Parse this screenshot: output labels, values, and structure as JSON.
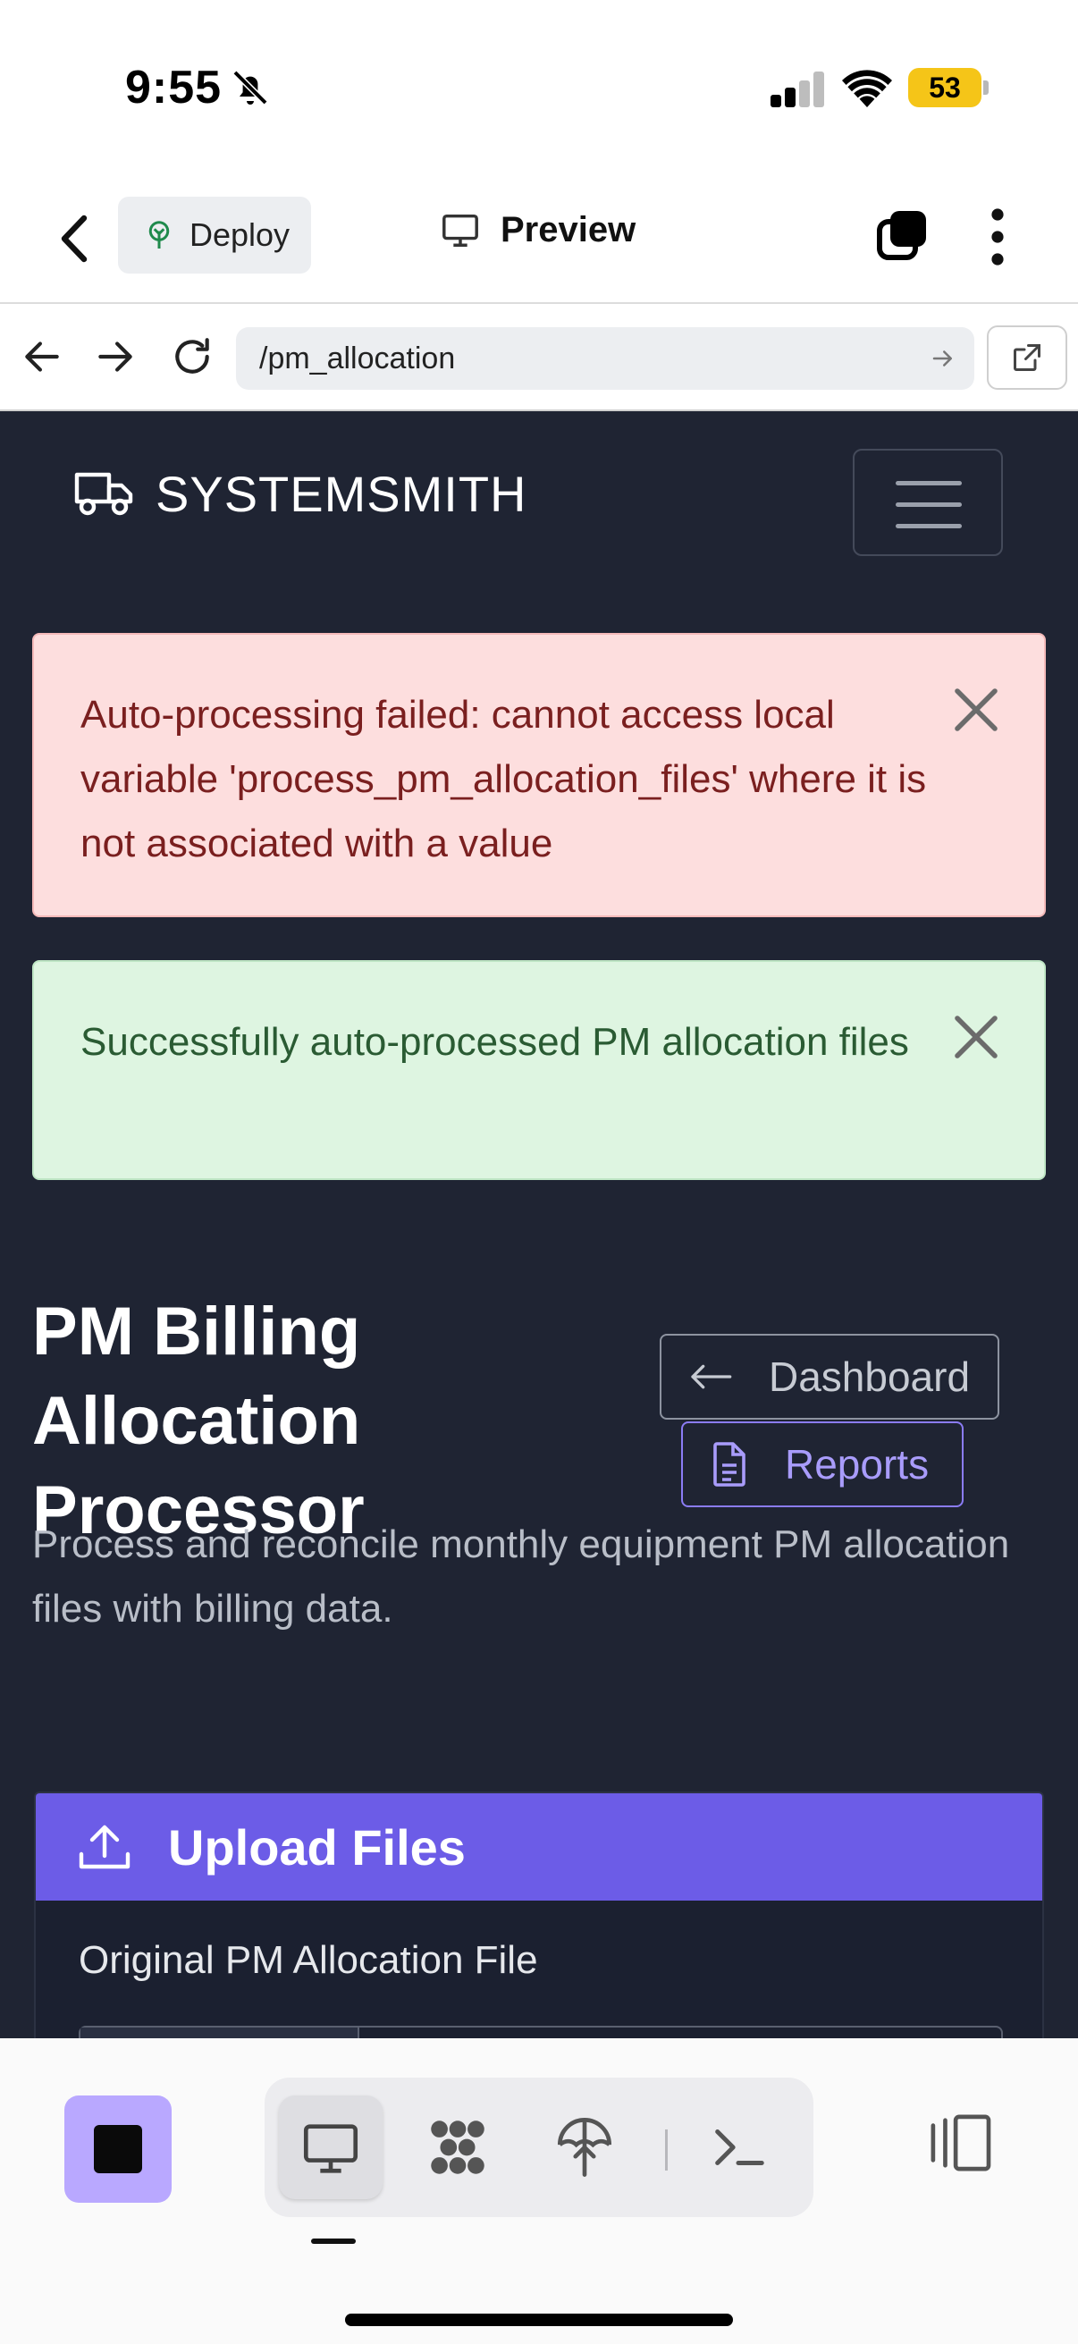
{
  "status_bar": {
    "time": "9:55",
    "battery": "53"
  },
  "app_bar": {
    "deploy_label": "Deploy",
    "title": "Preview"
  },
  "browser": {
    "url": "/pm_allocation"
  },
  "navbar": {
    "brand": "SYSTEMSMITH"
  },
  "alerts": {
    "error": "Auto-processing failed: cannot access local variable 'process_pm_allocation_files' where it is not associated with a value",
    "success": "Successfully auto-processed PM allocation files"
  },
  "page": {
    "title": "PM Billing Allocation Processor",
    "subtitle": "Process and reconcile monthly equipment PM allocation files with billing data.",
    "dashboard_button": "Dashboard",
    "reports_button": "Reports"
  },
  "upload": {
    "header": "Upload Files",
    "field_label": "Original PM Allocation File"
  },
  "colors": {
    "background": "#1f2433",
    "accent": "#6c5ce7",
    "error_bg": "#fddede",
    "success_bg": "#def5e1",
    "stop_button": "#b9a8ff"
  },
  "icons": [
    "bell-off-icon",
    "signal-icon",
    "wifi-icon",
    "back-chevron-icon",
    "deploy-icon",
    "monitor-icon",
    "tabs-icon",
    "kebab-icon",
    "arrow-left-icon",
    "arrow-right-icon",
    "reload-icon",
    "open-external-icon",
    "truck-icon",
    "hamburger-icon",
    "close-icon",
    "file-icon",
    "upload-icon",
    "stop-icon",
    "nodes-icon",
    "publish-icon",
    "terminal-icon",
    "panes-icon"
  ]
}
